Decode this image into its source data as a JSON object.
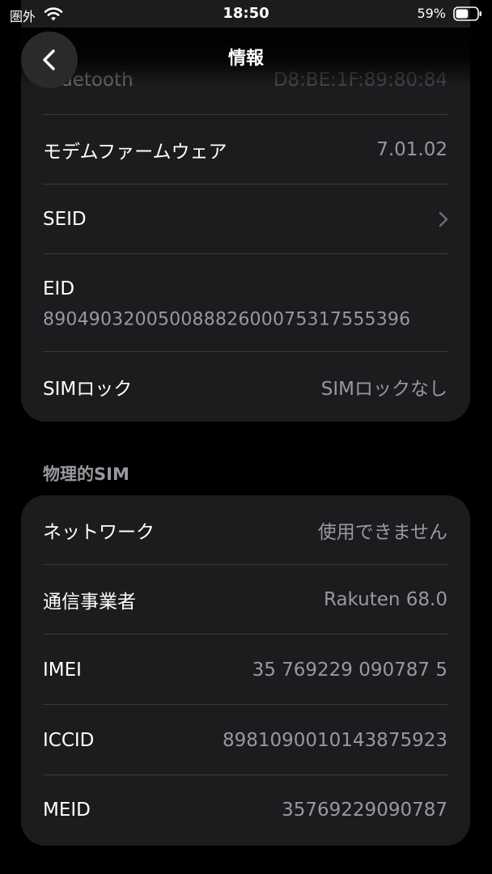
{
  "status_bar": {
    "carrier": "圏外",
    "time": "18:50",
    "battery_percent": "59%",
    "battery_level": 0.59
  },
  "header": {
    "title": "情報",
    "back_icon": "chevron-left-icon"
  },
  "about_rows": [
    {
      "label": "Bluetooth",
      "value": "D8:BE:1F:89:80:84"
    },
    {
      "label": "モデムファームウェア",
      "value": "7.01.02"
    },
    {
      "label": "SEID",
      "value": ""
    },
    {
      "label": "EID",
      "value": "89049032005008882600075317555396"
    },
    {
      "label": "SIMロック",
      "value": "SIMロックなし"
    }
  ],
  "physical_sim": {
    "section_title": "物理的SIM",
    "rows": [
      {
        "label": "ネットワーク",
        "value": "使用できません"
      },
      {
        "label": "通信事業者",
        "value": "Rakuten 68.0"
      },
      {
        "label": "IMEI",
        "value": "35 769229 090787 5"
      },
      {
        "label": "ICCID",
        "value": "8981090010143875923"
      },
      {
        "label": "MEID",
        "value": "35769229090787"
      }
    ]
  },
  "colors": {
    "background": "#000000",
    "card": "#1c1c1e",
    "separator": "#3a3a3c",
    "secondary_text": "#98989e"
  }
}
